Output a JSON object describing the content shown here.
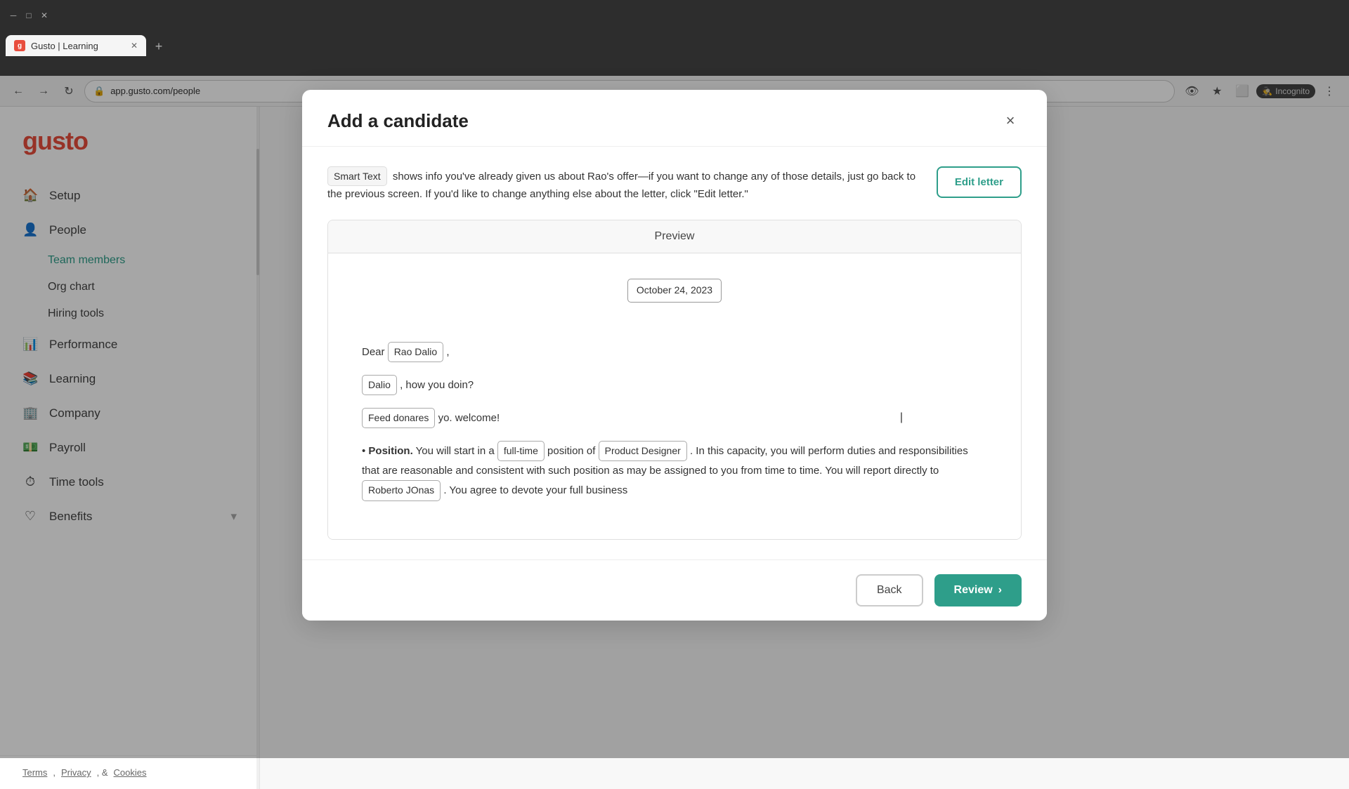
{
  "browser": {
    "tab_title": "Gusto | Learning",
    "url": "app.gusto.com/people",
    "incognito_label": "Incognito"
  },
  "sidebar": {
    "logo": "gusto",
    "nav_items": [
      {
        "id": "setup",
        "label": "Setup",
        "icon": "🏠"
      },
      {
        "id": "people",
        "label": "People",
        "icon": "👤"
      },
      {
        "id": "team-members",
        "label": "Team members",
        "sub": true,
        "active": true
      },
      {
        "id": "org-chart",
        "label": "Org chart",
        "sub": true
      },
      {
        "id": "hiring-tools",
        "label": "Hiring tools",
        "sub": true
      },
      {
        "id": "performance",
        "label": "Performance",
        "icon": "📊"
      },
      {
        "id": "learning",
        "label": "Learning",
        "icon": "📚"
      },
      {
        "id": "company",
        "label": "Company",
        "icon": "🏢"
      },
      {
        "id": "payroll",
        "label": "Payroll",
        "icon": "💵"
      },
      {
        "id": "time-tools",
        "label": "Time tools",
        "icon": "⏱"
      },
      {
        "id": "benefits",
        "label": "Benefits",
        "icon": "❤️",
        "has_arrow": true
      }
    ],
    "footer": {
      "terms": "Terms",
      "privacy": "Privacy",
      "cookies": "Cookies"
    }
  },
  "modal": {
    "title": "Add a candidate",
    "close_label": "×",
    "smart_text_label": "Smart Text",
    "info_text": "shows info you've already given us about Rao's offer—if you want to change any of those details, just go back to the previous screen. If you'd like to change anything else about the letter, click \"Edit letter.\"",
    "edit_letter_btn": "Edit letter",
    "preview": {
      "section_title": "Preview",
      "date_tag": "October 24, 2023",
      "dear_label": "Dear",
      "recipient_tag": "Rao Dalio",
      "comma": ",",
      "line1_name_tag": "Dalio",
      "line1_rest": ", how you doin?",
      "line2_tag": "Feed donares",
      "line2_rest": "yo. welcome!",
      "position_label": "Position.",
      "position_text1": "You will start in a",
      "full_time_tag": "full-time",
      "position_text2": "position of",
      "product_designer_tag": "Product Designer",
      "position_text3": ". In this capacity, you will perform duties and responsibilities that are reasonable and consistent with such position as may be assigned to you from time to time. You will report directly to",
      "roberto_tag": "Roberto JOnas",
      "position_text4": ". You agree to devote your full business"
    },
    "back_btn": "Back",
    "review_btn": "Review"
  }
}
